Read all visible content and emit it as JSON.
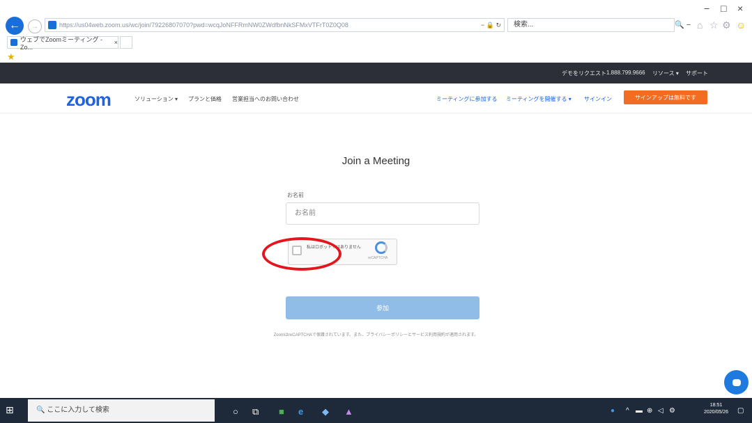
{
  "browser": {
    "url": "https://us04web.zoom.us/wc/join/79226807070?pwd=wcqJoNFFRmNW0ZWdfbnNkSFMxVTFrT0Z0Q08",
    "search_placeholder": "検索...",
    "tab_title": "ウェブでZoomミーティング - Zo...",
    "window_controls": [
      "−",
      "□",
      "×"
    ],
    "address_icons": "− 🔒 ↻",
    "search_icon": "🔍 −"
  },
  "zoom_utility": {
    "links": [
      "デモをリクエスト",
      "1.888.799.9666",
      "リソース ▾",
      "サポート"
    ]
  },
  "zoom_nav": {
    "logo": "zoom",
    "left_links": [
      "ソリューション ▾",
      "プランと価格",
      "営業担当へのお問い合わせ"
    ],
    "right_links": [
      "ミーティングに参加する",
      "ミーティングを開催する ▾",
      "サインイン"
    ],
    "signup_label": "サインアップは無料です"
  },
  "join_form": {
    "title": "Join a Meeting",
    "name_label": "お名前",
    "name_placeholder": "お名前",
    "captcha_text": "私はロボットではありません",
    "captcha_brand": "reCAPTCHA",
    "join_label": "参加",
    "recaptcha_note": "ZoomはreCAPTCHAで保護されています。また、プライバシーポリシーとサービス利用規約が適用されます。"
  },
  "taskbar": {
    "search_placeholder": "ここに入力して検索",
    "clock_time": "18:51",
    "clock_date": "2020/05/26"
  },
  "colors": {
    "zoom_blue": "#1f63e0",
    "signup_orange": "#f26d21",
    "join_button": "#8fbde7",
    "highlight_red": "#e3161d",
    "utility_bar": "#2d2f38",
    "taskbar": "#1e2a3a"
  }
}
